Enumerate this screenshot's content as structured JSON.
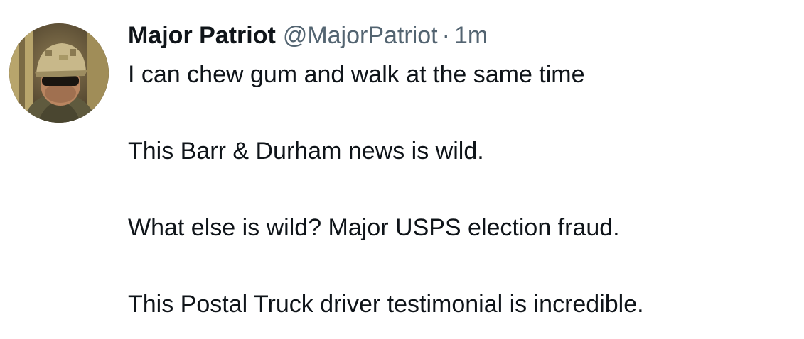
{
  "tweet": {
    "author": {
      "display_name": "Major Patriot",
      "handle": "@MajorPatriot",
      "avatar_icon": "profile-photo-soldier"
    },
    "separator": "·",
    "timestamp": "1m",
    "paragraphs": [
      "I can chew gum and walk at the same time",
      "This Barr & Durham news is wild.",
      "What else is wild?  Major USPS election fraud.",
      "This Postal Truck driver testimonial is incredible."
    ]
  }
}
